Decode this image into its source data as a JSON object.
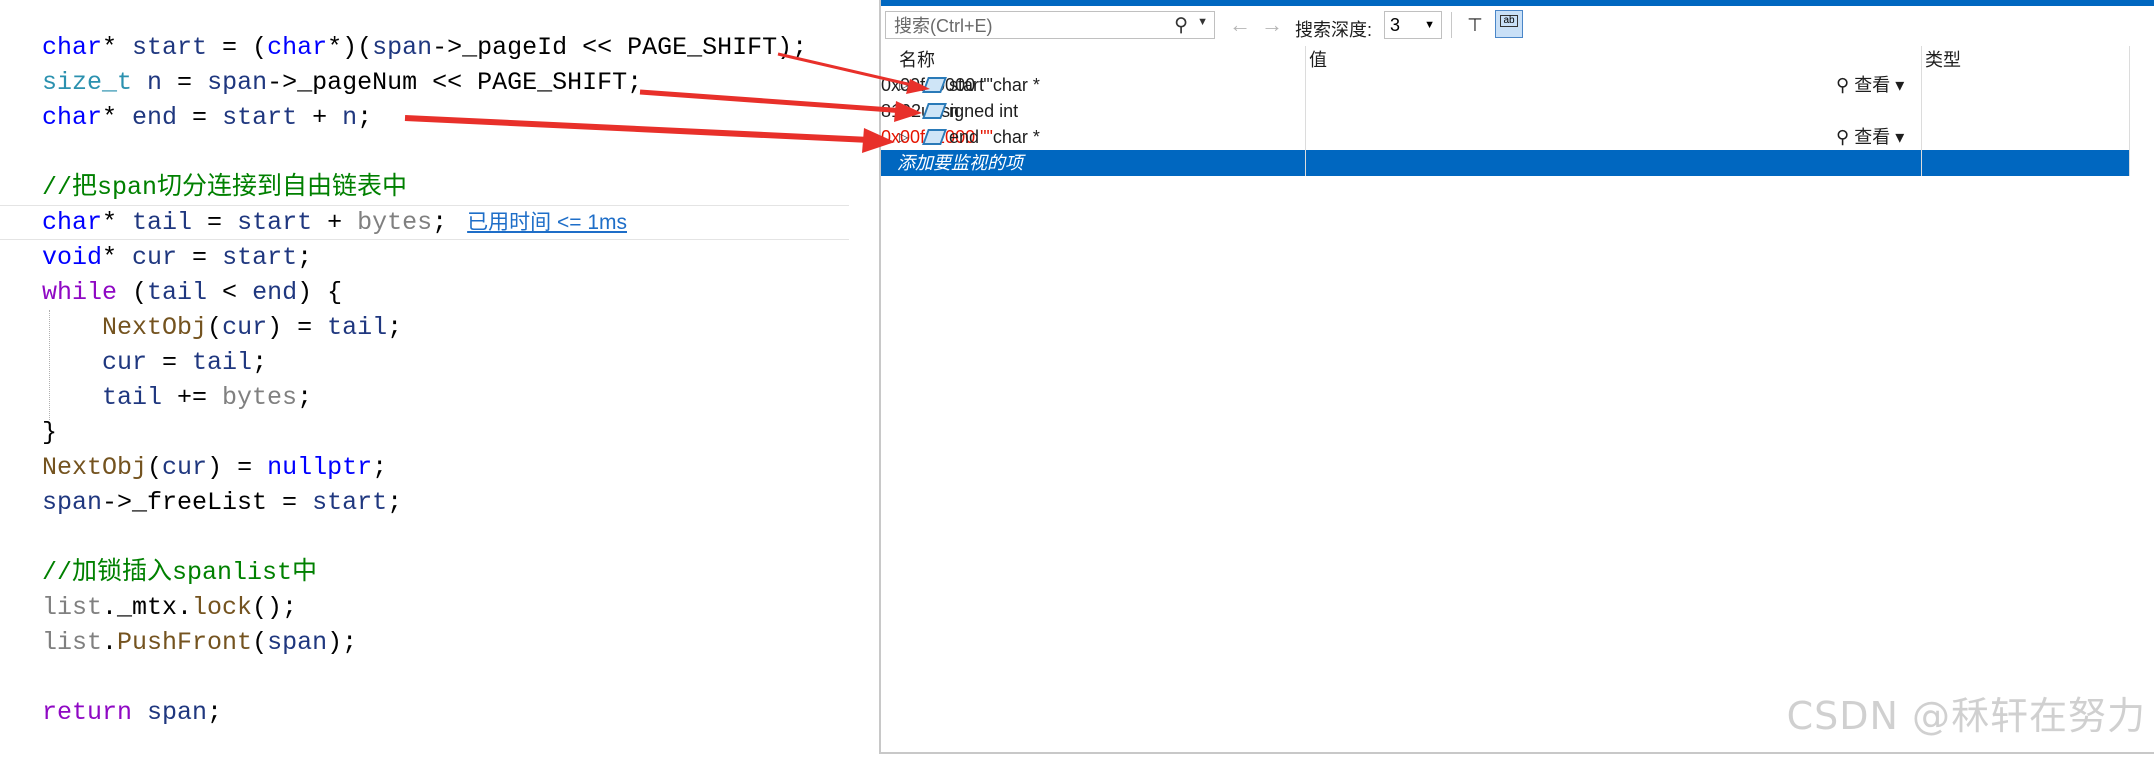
{
  "editor": {
    "lines": [
      [
        [
          "kw",
          "char"
        ],
        [
          "plain",
          "* "
        ],
        [
          "var",
          "start"
        ],
        [
          "plain",
          " = ("
        ],
        [
          "kw",
          "char"
        ],
        [
          "plain",
          "*)("
        ],
        [
          "var",
          "span"
        ],
        [
          "plain",
          "->_pageId << PAGE_SHIFT);"
        ]
      ],
      [
        [
          "ty",
          "size_t"
        ],
        [
          "plain",
          " "
        ],
        [
          "var",
          "n"
        ],
        [
          "plain",
          " = "
        ],
        [
          "var",
          "span"
        ],
        [
          "plain",
          "->_pageNum << PAGE_SHIFT;"
        ]
      ],
      [
        [
          "kw",
          "char"
        ],
        [
          "plain",
          "* "
        ],
        [
          "var",
          "end"
        ],
        [
          "plain",
          " = "
        ],
        [
          "var",
          "start"
        ],
        [
          "plain",
          " + "
        ],
        [
          "var",
          "n"
        ],
        [
          "plain",
          ";"
        ]
      ],
      [],
      [
        [
          "cm",
          "//把span切分连接到自由链表中"
        ]
      ],
      [
        [
          "kw",
          "char"
        ],
        [
          "plain",
          "* "
        ],
        [
          "var",
          "tail"
        ],
        [
          "plain",
          " = "
        ],
        [
          "var",
          "start"
        ],
        [
          "plain",
          " + "
        ],
        [
          "prm",
          "bytes"
        ],
        [
          "plain",
          ";"
        ]
      ],
      [
        [
          "kw",
          "void"
        ],
        [
          "plain",
          "* "
        ],
        [
          "var",
          "cur"
        ],
        [
          "plain",
          " = "
        ],
        [
          "var",
          "start"
        ],
        [
          "plain",
          ";"
        ]
      ],
      [
        [
          "kw2",
          "while"
        ],
        [
          "plain",
          " ("
        ],
        [
          "var",
          "tail"
        ],
        [
          "plain",
          " < "
        ],
        [
          "var",
          "end"
        ],
        [
          "plain",
          ") {"
        ]
      ],
      [
        [
          "plain",
          "    "
        ],
        [
          "fn",
          "NextObj"
        ],
        [
          "plain",
          "("
        ],
        [
          "var",
          "cur"
        ],
        [
          "plain",
          ") = "
        ],
        [
          "var",
          "tail"
        ],
        [
          "plain",
          ";"
        ]
      ],
      [
        [
          "plain",
          "    "
        ],
        [
          "var",
          "cur"
        ],
        [
          "plain",
          " = "
        ],
        [
          "var",
          "tail"
        ],
        [
          "plain",
          ";"
        ]
      ],
      [
        [
          "plain",
          "    "
        ],
        [
          "var",
          "tail"
        ],
        [
          "plain",
          " += "
        ],
        [
          "prm",
          "bytes"
        ],
        [
          "plain",
          ";"
        ]
      ],
      [
        [
          "plain",
          "}"
        ]
      ],
      [
        [
          "fn",
          "NextObj"
        ],
        [
          "plain",
          "("
        ],
        [
          "var",
          "cur"
        ],
        [
          "plain",
          ") = "
        ],
        [
          "kw",
          "nullptr"
        ],
        [
          "plain",
          ";"
        ]
      ],
      [
        [
          "var",
          "span"
        ],
        [
          "plain",
          "->_freeList = "
        ],
        [
          "var",
          "start"
        ],
        [
          "plain",
          ";"
        ]
      ],
      [],
      [
        [
          "cm",
          "//加锁插入spanlist中"
        ]
      ],
      [
        [
          "prm",
          "list"
        ],
        [
          "plain",
          "._mtx."
        ],
        [
          "fn",
          "lock"
        ],
        [
          "plain",
          "();"
        ]
      ],
      [
        [
          "prm",
          "list"
        ],
        [
          "plain",
          "."
        ],
        [
          "fn",
          "PushFront"
        ],
        [
          "plain",
          "("
        ],
        [
          "var",
          "span"
        ],
        [
          "plain",
          ");"
        ]
      ],
      [],
      [
        [
          "kw2",
          "return"
        ],
        [
          "plain",
          " "
        ],
        [
          "var",
          "span"
        ],
        [
          "plain",
          ";"
        ]
      ]
    ],
    "elapsed_hint": "已用时间 <= 1ms"
  },
  "watch": {
    "search_placeholder": "搜索(Ctrl+E)",
    "depth_label": "搜索深度:",
    "depth_value": "3",
    "columns": {
      "name": "名称",
      "value": "值",
      "type": "类型"
    },
    "rows": [
      {
        "name": "start",
        "value": "0x00fd0000 \"\"",
        "type": "char *",
        "view": "查看",
        "expandable": true,
        "changed": false
      },
      {
        "name": "n",
        "value": "8192",
        "type": "unsigned int",
        "view": "",
        "expandable": false,
        "changed": false
      },
      {
        "name": "end",
        "value": "0x00fd2000 \"\"",
        "type": "char *",
        "view": "查看",
        "expandable": true,
        "changed": true
      }
    ],
    "add_item": "添加要监视的项"
  },
  "watermark": "CSDN @秝轩在努力",
  "colors": {
    "accent": "#0067c0",
    "arrow": "#e8302a",
    "changed_value": "#e51400"
  }
}
